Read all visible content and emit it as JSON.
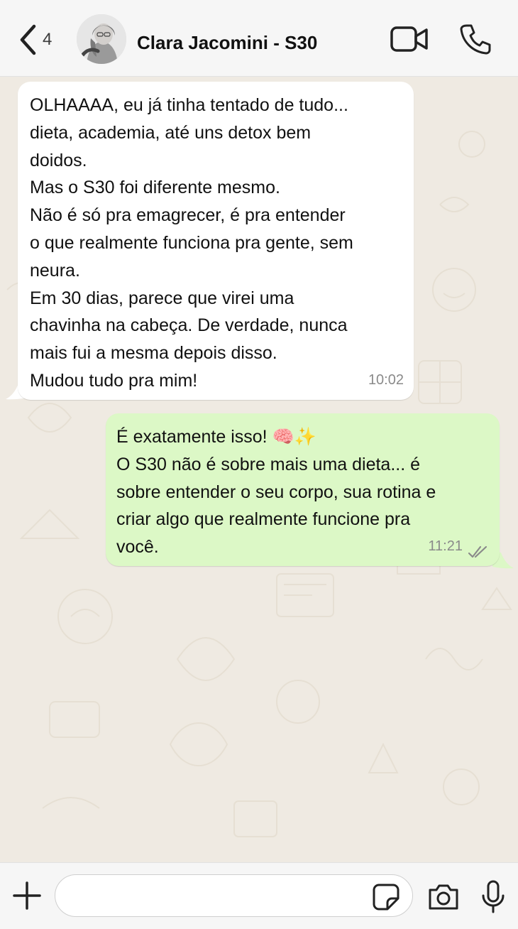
{
  "header": {
    "back_count": "4",
    "contact_name": "Clara Jacomini - S30"
  },
  "messages": {
    "incoming": {
      "lines": [
        "OLHAAAA, eu já tinha tentado de tudo...",
        "dieta, academia, até uns detox bem",
        "doidos.",
        "Mas o S30 foi diferente mesmo.",
        "Não é só pra emagrecer, é pra entender",
        "o que realmente funciona pra gente, sem",
        "neura.",
        "Em 30 dias, parece que virei uma",
        "chavinha na cabeça. De verdade, nunca",
        "mais fui a mesma depois disso.",
        "Mudou tudo pra mim!"
      ],
      "time": "10:02"
    },
    "outgoing": {
      "lines": [
        "É exatamente isso! 🧠✨",
        "O S30 não é sobre mais uma dieta... é",
        "sobre entender o seu corpo, sua rotina e",
        "criar algo que realmente funcione pra",
        "você."
      ],
      "time": "11:21",
      "status": "read"
    }
  },
  "composer": {
    "placeholder": ""
  },
  "colors": {
    "header_bg": "#f6f6f6",
    "chat_bg": "#efeae2",
    "incoming_bubble": "#ffffff",
    "outgoing_bubble": "#dcf8c6",
    "timestamp": "#8a8a8a"
  },
  "icons": {
    "back": "chevron-left-icon",
    "video": "video-camera-icon",
    "call": "phone-icon",
    "attach": "plus-icon",
    "sticker": "sticker-icon",
    "camera": "camera-icon",
    "mic": "microphone-icon",
    "read_status": "double-check-icon"
  }
}
